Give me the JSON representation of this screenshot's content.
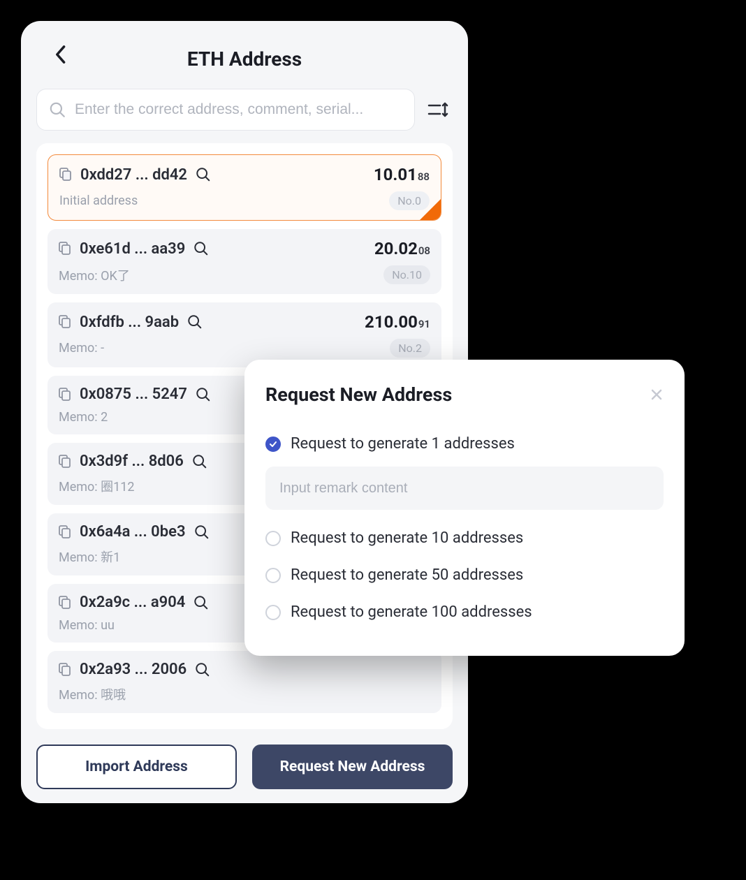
{
  "header": {
    "title": "ETH Address"
  },
  "search": {
    "placeholder": "Enter the correct address, comment, serial..."
  },
  "addresses": [
    {
      "address": "0xdd27 ... dd42",
      "balance_main": "10.01",
      "balance_sub": "88",
      "memo": "Initial address",
      "no": "No.0",
      "selected": true
    },
    {
      "address": "0xe61d ... aa39",
      "balance_main": "20.02",
      "balance_sub": "08",
      "memo": "Memo: OK了",
      "no": "No.10",
      "selected": false
    },
    {
      "address": "0xfdfb ... 9aab",
      "balance_main": "210.00",
      "balance_sub": "91",
      "memo": "Memo: -",
      "no": "No.2",
      "selected": false
    },
    {
      "address": "0x0875 ... 5247",
      "balance_main": "",
      "balance_sub": "",
      "memo": "Memo: 2",
      "no": "",
      "selected": false
    },
    {
      "address": "0x3d9f ... 8d06",
      "balance_main": "",
      "balance_sub": "",
      "memo": "Memo: 圈112",
      "no": "",
      "selected": false
    },
    {
      "address": "0x6a4a ... 0be3",
      "balance_main": "",
      "balance_sub": "",
      "memo": "Memo: 新1",
      "no": "",
      "selected": false
    },
    {
      "address": "0x2a9c ... a904",
      "balance_main": "",
      "balance_sub": "",
      "memo": "Memo: uu",
      "no": "",
      "selected": false
    },
    {
      "address": "0x2a93 ... 2006",
      "balance_main": "",
      "balance_sub": "",
      "memo": "Memo: 哦哦",
      "no": "",
      "selected": false
    }
  ],
  "footer": {
    "import_label": "Import Address",
    "request_label": "Request New Address"
  },
  "modal": {
    "title": "Request New Address",
    "remark_placeholder": "Input remark content",
    "options": [
      {
        "label": "Request to generate 1 addresses",
        "checked": true
      },
      {
        "label": "Request to generate 10 addresses",
        "checked": false
      },
      {
        "label": "Request to generate 50 addresses",
        "checked": false
      },
      {
        "label": "Request to generate 100 addresses",
        "checked": false
      }
    ]
  }
}
